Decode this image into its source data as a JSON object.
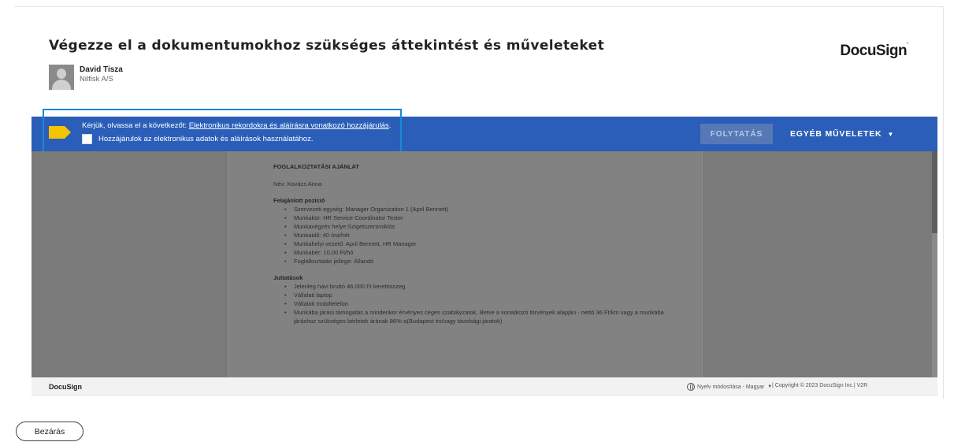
{
  "header": {
    "title": "Végezze el a dokumentumokhoz szükséges áttekintést és műveleteket",
    "sender_name": "David Tisza",
    "sender_org": "Nilfisk A/S",
    "logo": "DocuSign"
  },
  "bluebar": {
    "color": "#2a5eb8",
    "message_prefix": "Kérjük, olvassa el a következőt: ",
    "message_link": "Elektronikus rekordokra és aláírásra vonatkozó hozzájárulás",
    "message_suffix": ".",
    "consent_label": "Hozzájárulok az elektronikus adatok és aláírások használatához.",
    "consent_checked": false,
    "continue_label": "FOLYTATÁS",
    "more_actions_label": "EGYÉB MŰVELETEK",
    "more_actions_icon": "caret-down-icon"
  },
  "document": {
    "heading": "FOGLALKOZTATÁSI AJÁNLAT",
    "name_line": "Név: Kovács Anna",
    "position_heading": "Felajánlott pozíció",
    "position_items": [
      "Szervezeti egység: Manager Organization 1 (April Bennett)",
      "Munkakör: HR Service Coordinator Tester",
      "Munkavégzés helye:Szigetszentmiklós",
      "Munkaidő: 40 óra/hét",
      "Munkahelyi vezető: April Bennett, HR Manager",
      "Munkabér: 10,00 Ft/hó",
      "Foglalkoztatás jellege: Állandó"
    ],
    "benefits_heading": "Juttatások",
    "benefits_items": [
      "Jelenleg havi bruttó 46.000 Ft keretösszeg",
      "Vállalati laptop",
      "Vállalati mobiltelefon",
      "Munkába járási támogatás a mindenkor érvényes céges szabályzatok, illetve a vonatkozó törvények alapján - nettó 36 Ft/km vagy a munkába járáshoz szükséges bérletek árának 86%-a(Budapest és/vagy távolsági járatok)"
    ]
  },
  "footer": {
    "logo": "DocuSign",
    "language_label": "Nyelv módosítása - Magyar",
    "language_icon": "globe-icon",
    "copyright": "|  Copyright © 2023 DocuSign Inc.|  V2R"
  },
  "close_button": "Bezárás"
}
